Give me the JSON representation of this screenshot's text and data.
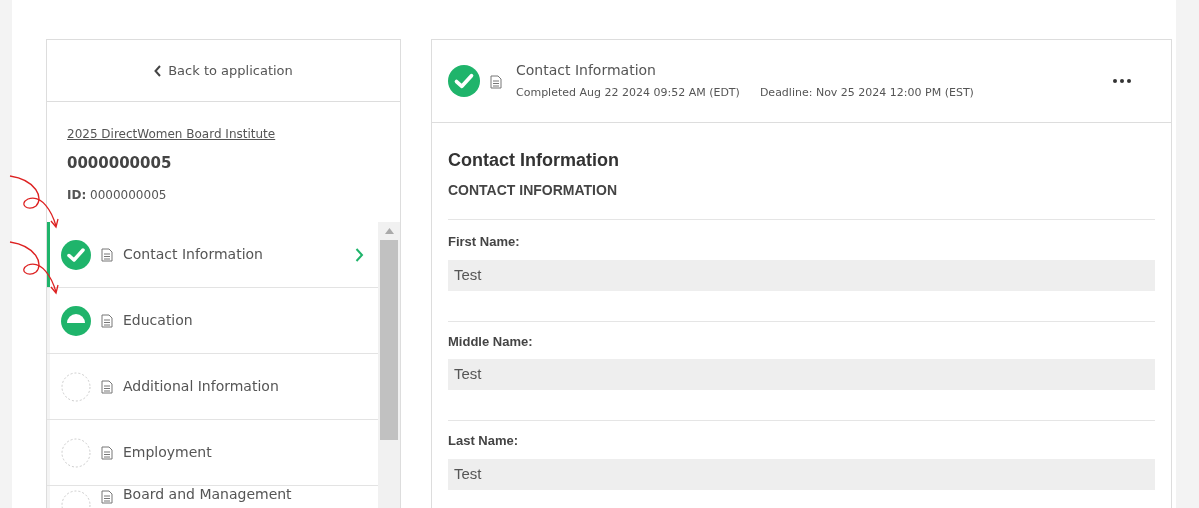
{
  "back_link": "Back to application",
  "application": {
    "program": "2025 DirectWomen Board Institute",
    "number": "0000000005",
    "id_label": "ID:",
    "id_value": "0000000005"
  },
  "sections": [
    {
      "label": "Contact Information",
      "kind": "complete",
      "selected": true
    },
    {
      "label": "Education",
      "kind": "partial",
      "selected": false
    },
    {
      "label": "Additional Information",
      "kind": "empty",
      "selected": false
    },
    {
      "label": "Employment",
      "kind": "empty",
      "selected": false
    },
    {
      "label": "Board and Management",
      "kind": "empty",
      "selected": false
    }
  ],
  "detail": {
    "kind": "complete",
    "title": "Contact Information",
    "completed": "Completed Aug 22 2024 09:52 AM (EDT)",
    "deadline": "Deadline: Nov 25 2024 12:00 PM (EST)",
    "heading": "Contact Information",
    "subheading": "CONTACT INFORMATION",
    "fields": [
      {
        "label": "First Name:",
        "value": "Test"
      },
      {
        "label": "Middle Name:",
        "value": "Test"
      },
      {
        "label": "Last Name:",
        "value": "Test"
      }
    ]
  }
}
